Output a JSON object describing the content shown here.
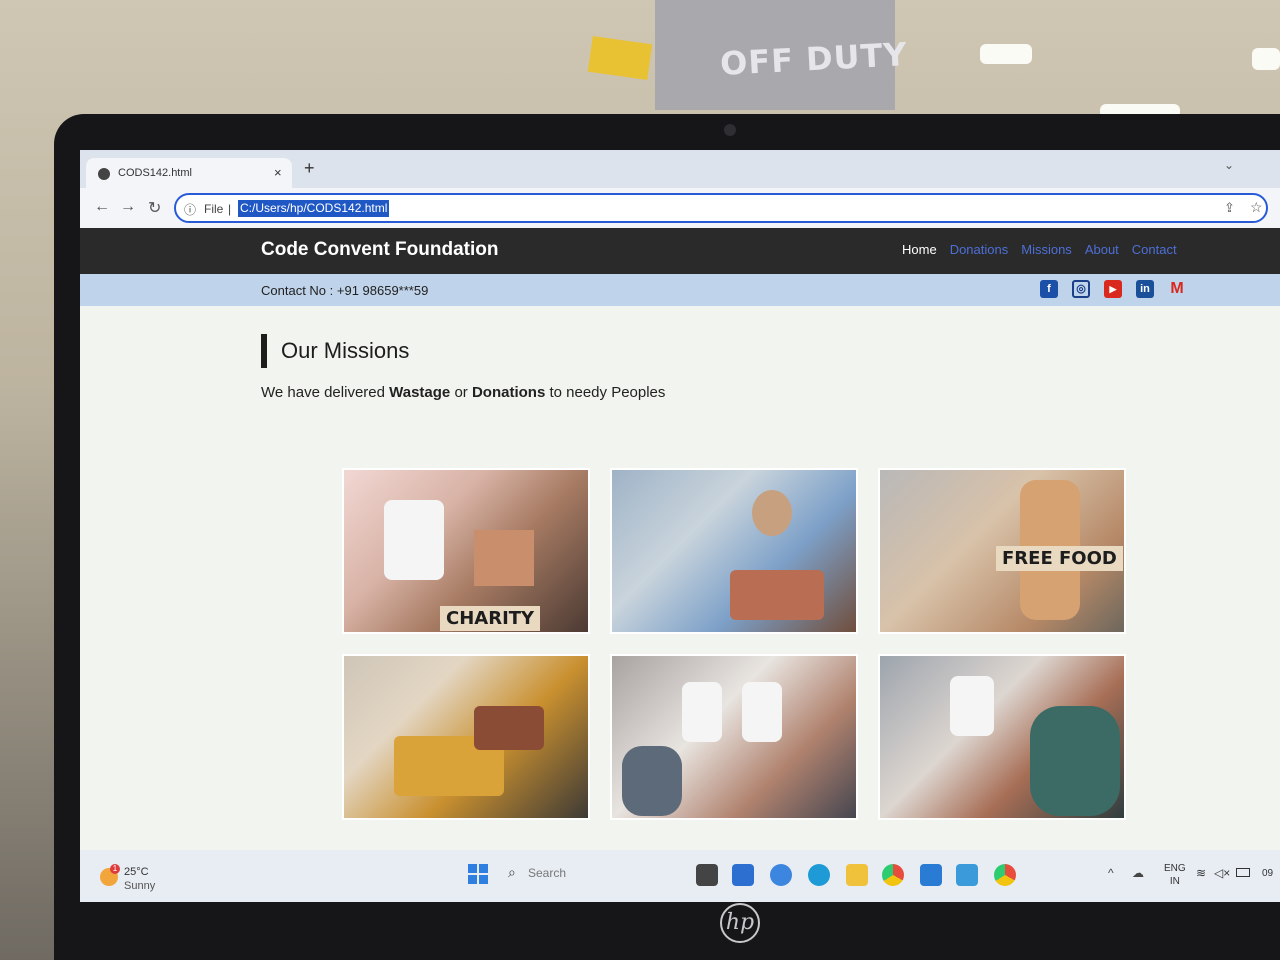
{
  "browser": {
    "tab_title": "CODS142.html",
    "tab_close": "×",
    "new_tab": "+",
    "address_prefix": "File",
    "address_url": "C:/Users/hp/CODS142.html"
  },
  "site": {
    "brand": "Code Convent Foundation",
    "nav": [
      "Home",
      "Donations",
      "Missions",
      "About",
      "Contact"
    ],
    "contact": "Contact No : +91 98659***59",
    "socials": [
      "facebook-icon",
      "instagram-icon",
      "youtube-icon",
      "linkedin-icon",
      "gmail-icon"
    ],
    "section_title": "Our Missions",
    "description": {
      "part1": "We have delivered ",
      "bold1": "Wastage",
      "part2": " or ",
      "bold2": "Donations",
      "part3": " to needy Peoples"
    },
    "photo_captions": [
      "CHARITY",
      "FREE FOOD"
    ]
  },
  "room": {
    "sign_text": "OFF DUTY"
  },
  "taskbar": {
    "temperature": "25°C",
    "condition": "Sunny",
    "weather_badge": "1",
    "search": "Search",
    "lang_top": "ENG",
    "lang_bottom": "IN",
    "time": "09"
  },
  "colors": {
    "header_bg": "#2a2a2a",
    "nav_link": "#4d6fd6",
    "contact_bar": "#bfd3ea"
  }
}
